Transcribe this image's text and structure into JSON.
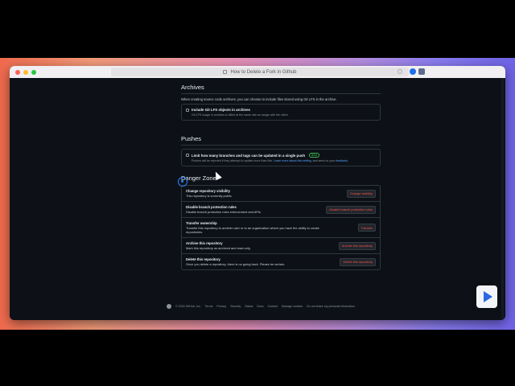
{
  "browser": {
    "tab_title": "How to Delete a Fork in Github"
  },
  "archives": {
    "heading": "Archives",
    "description": "When creating source code archives, you can choose to include files stored using Git LFS in the archive.",
    "checkbox_label": "Include Git LFS objects in archives",
    "checkbox_note": "Git LFS usage in archives is billed at the same rate as usage with the client."
  },
  "pushes": {
    "heading": "Pushes",
    "checkbox_label": "Limit how many branches and tags can be updated in a single push",
    "badge": "Beta",
    "note_prefix": "Pushes will be rejected if they attempt to update more than this.",
    "note_link": "Learn more about this setting",
    "note_middle": ", and send us your",
    "note_feedback": "feedback",
    "note_suffix": "."
  },
  "danger": {
    "heading": "Danger Zone",
    "rows": [
      {
        "title": "Change repository visibility",
        "desc": "This repository is currently public.",
        "button": "Change visibility"
      },
      {
        "title": "Disable branch protection rules",
        "desc": "Disable branch protection rules enforcement and APIs",
        "button": "Disable branch protection rules"
      },
      {
        "title": "Transfer ownership",
        "desc": "Transfer this repository to another user or to an organization where you have the ability to create repositories.",
        "button": "Transfer"
      },
      {
        "title": "Archive this repository",
        "desc": "Mark this repository as archived and read-only.",
        "button": "Archive this repository"
      },
      {
        "title": "Delete this repository",
        "desc": "Once you delete a repository, there is no going back. Please be certain.",
        "button": "Delete this repository"
      }
    ]
  },
  "footer": {
    "copyright": "© 2024 GitHub, Inc.",
    "links": [
      "Terms",
      "Privacy",
      "Security",
      "Status",
      "Docs",
      "Contact",
      "Manage cookies",
      "Do not share my personal information"
    ]
  },
  "icons": {
    "lock": "lock-icon",
    "reload": "reload-icon",
    "play": "play-icon",
    "github": "github-logo-icon",
    "cursor": "cursor-icon"
  },
  "colors": {
    "danger": "#f85149",
    "link": "#58a6ff",
    "background": "#0d1117",
    "badge": "#3fb950"
  }
}
